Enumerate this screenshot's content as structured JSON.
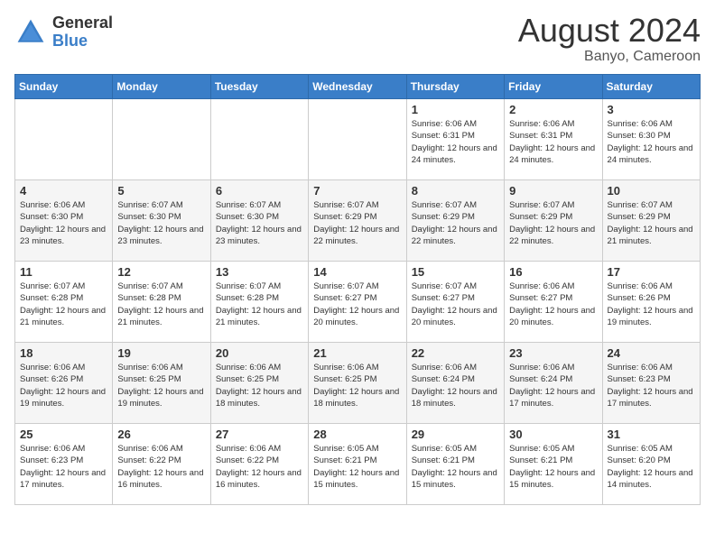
{
  "logo": {
    "general": "General",
    "blue": "Blue"
  },
  "title": "August 2024",
  "location": "Banyo, Cameroon",
  "weekdays": [
    "Sunday",
    "Monday",
    "Tuesday",
    "Wednesday",
    "Thursday",
    "Friday",
    "Saturday"
  ],
  "weeks": [
    [
      {
        "day": "",
        "sunrise": "",
        "sunset": "",
        "daylight": ""
      },
      {
        "day": "",
        "sunrise": "",
        "sunset": "",
        "daylight": ""
      },
      {
        "day": "",
        "sunrise": "",
        "sunset": "",
        "daylight": ""
      },
      {
        "day": "",
        "sunrise": "",
        "sunset": "",
        "daylight": ""
      },
      {
        "day": "1",
        "sunrise": "Sunrise: 6:06 AM",
        "sunset": "Sunset: 6:31 PM",
        "daylight": "Daylight: 12 hours and 24 minutes."
      },
      {
        "day": "2",
        "sunrise": "Sunrise: 6:06 AM",
        "sunset": "Sunset: 6:31 PM",
        "daylight": "Daylight: 12 hours and 24 minutes."
      },
      {
        "day": "3",
        "sunrise": "Sunrise: 6:06 AM",
        "sunset": "Sunset: 6:30 PM",
        "daylight": "Daylight: 12 hours and 24 minutes."
      }
    ],
    [
      {
        "day": "4",
        "sunrise": "Sunrise: 6:06 AM",
        "sunset": "Sunset: 6:30 PM",
        "daylight": "Daylight: 12 hours and 23 minutes."
      },
      {
        "day": "5",
        "sunrise": "Sunrise: 6:07 AM",
        "sunset": "Sunset: 6:30 PM",
        "daylight": "Daylight: 12 hours and 23 minutes."
      },
      {
        "day": "6",
        "sunrise": "Sunrise: 6:07 AM",
        "sunset": "Sunset: 6:30 PM",
        "daylight": "Daylight: 12 hours and 23 minutes."
      },
      {
        "day": "7",
        "sunrise": "Sunrise: 6:07 AM",
        "sunset": "Sunset: 6:29 PM",
        "daylight": "Daylight: 12 hours and 22 minutes."
      },
      {
        "day": "8",
        "sunrise": "Sunrise: 6:07 AM",
        "sunset": "Sunset: 6:29 PM",
        "daylight": "Daylight: 12 hours and 22 minutes."
      },
      {
        "day": "9",
        "sunrise": "Sunrise: 6:07 AM",
        "sunset": "Sunset: 6:29 PM",
        "daylight": "Daylight: 12 hours and 22 minutes."
      },
      {
        "day": "10",
        "sunrise": "Sunrise: 6:07 AM",
        "sunset": "Sunset: 6:29 PM",
        "daylight": "Daylight: 12 hours and 21 minutes."
      }
    ],
    [
      {
        "day": "11",
        "sunrise": "Sunrise: 6:07 AM",
        "sunset": "Sunset: 6:28 PM",
        "daylight": "Daylight: 12 hours and 21 minutes."
      },
      {
        "day": "12",
        "sunrise": "Sunrise: 6:07 AM",
        "sunset": "Sunset: 6:28 PM",
        "daylight": "Daylight: 12 hours and 21 minutes."
      },
      {
        "day": "13",
        "sunrise": "Sunrise: 6:07 AM",
        "sunset": "Sunset: 6:28 PM",
        "daylight": "Daylight: 12 hours and 21 minutes."
      },
      {
        "day": "14",
        "sunrise": "Sunrise: 6:07 AM",
        "sunset": "Sunset: 6:27 PM",
        "daylight": "Daylight: 12 hours and 20 minutes."
      },
      {
        "day": "15",
        "sunrise": "Sunrise: 6:07 AM",
        "sunset": "Sunset: 6:27 PM",
        "daylight": "Daylight: 12 hours and 20 minutes."
      },
      {
        "day": "16",
        "sunrise": "Sunrise: 6:06 AM",
        "sunset": "Sunset: 6:27 PM",
        "daylight": "Daylight: 12 hours and 20 minutes."
      },
      {
        "day": "17",
        "sunrise": "Sunrise: 6:06 AM",
        "sunset": "Sunset: 6:26 PM",
        "daylight": "Daylight: 12 hours and 19 minutes."
      }
    ],
    [
      {
        "day": "18",
        "sunrise": "Sunrise: 6:06 AM",
        "sunset": "Sunset: 6:26 PM",
        "daylight": "Daylight: 12 hours and 19 minutes."
      },
      {
        "day": "19",
        "sunrise": "Sunrise: 6:06 AM",
        "sunset": "Sunset: 6:25 PM",
        "daylight": "Daylight: 12 hours and 19 minutes."
      },
      {
        "day": "20",
        "sunrise": "Sunrise: 6:06 AM",
        "sunset": "Sunset: 6:25 PM",
        "daylight": "Daylight: 12 hours and 18 minutes."
      },
      {
        "day": "21",
        "sunrise": "Sunrise: 6:06 AM",
        "sunset": "Sunset: 6:25 PM",
        "daylight": "Daylight: 12 hours and 18 minutes."
      },
      {
        "day": "22",
        "sunrise": "Sunrise: 6:06 AM",
        "sunset": "Sunset: 6:24 PM",
        "daylight": "Daylight: 12 hours and 18 minutes."
      },
      {
        "day": "23",
        "sunrise": "Sunrise: 6:06 AM",
        "sunset": "Sunset: 6:24 PM",
        "daylight": "Daylight: 12 hours and 17 minutes."
      },
      {
        "day": "24",
        "sunrise": "Sunrise: 6:06 AM",
        "sunset": "Sunset: 6:23 PM",
        "daylight": "Daylight: 12 hours and 17 minutes."
      }
    ],
    [
      {
        "day": "25",
        "sunrise": "Sunrise: 6:06 AM",
        "sunset": "Sunset: 6:23 PM",
        "daylight": "Daylight: 12 hours and 17 minutes."
      },
      {
        "day": "26",
        "sunrise": "Sunrise: 6:06 AM",
        "sunset": "Sunset: 6:22 PM",
        "daylight": "Daylight: 12 hours and 16 minutes."
      },
      {
        "day": "27",
        "sunrise": "Sunrise: 6:06 AM",
        "sunset": "Sunset: 6:22 PM",
        "daylight": "Daylight: 12 hours and 16 minutes."
      },
      {
        "day": "28",
        "sunrise": "Sunrise: 6:05 AM",
        "sunset": "Sunset: 6:21 PM",
        "daylight": "Daylight: 12 hours and 15 minutes."
      },
      {
        "day": "29",
        "sunrise": "Sunrise: 6:05 AM",
        "sunset": "Sunset: 6:21 PM",
        "daylight": "Daylight: 12 hours and 15 minutes."
      },
      {
        "day": "30",
        "sunrise": "Sunrise: 6:05 AM",
        "sunset": "Sunset: 6:21 PM",
        "daylight": "Daylight: 12 hours and 15 minutes."
      },
      {
        "day": "31",
        "sunrise": "Sunrise: 6:05 AM",
        "sunset": "Sunset: 6:20 PM",
        "daylight": "Daylight: 12 hours and 14 minutes."
      }
    ]
  ]
}
